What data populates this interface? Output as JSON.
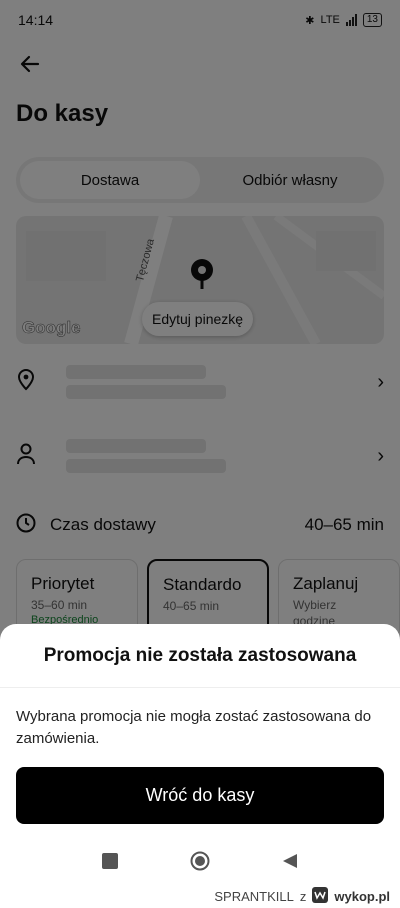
{
  "status": {
    "time": "14:14",
    "network": "LTE",
    "battery": "13"
  },
  "page": {
    "title": "Do kasy"
  },
  "tabs": [
    {
      "label": "Dostawa",
      "active": true
    },
    {
      "label": "Odbiór własny",
      "active": false
    }
  ],
  "map": {
    "attribution": "Google",
    "street": "Tęczowa",
    "edit_pin_label": "Edytuj pinezkę"
  },
  "delivery": {
    "label": "Czas dostawy",
    "range": "40–65 min"
  },
  "options": [
    {
      "name": "Priorytet",
      "time": "35–60 min",
      "note": "Bezpośrednio"
    },
    {
      "name": "Standardo",
      "time": "40–65 min",
      "note": ""
    },
    {
      "name": "Zaplanuj",
      "time": "Wybierz",
      "note": "godzinę"
    }
  ],
  "dialog": {
    "title": "Promocja nie została zastosowana",
    "message": "Wybrana promocja nie mogła zostać zastosowana do zamówienia.",
    "button": "Wróć do kasy"
  },
  "watermark": {
    "user": "SPRANTKILL",
    "sep": "z",
    "brand": "wykop.pl"
  },
  "colors": {
    "dim_overlay": "#00000080",
    "primary_button": "#000000",
    "success_text": "#1a8a3a"
  }
}
